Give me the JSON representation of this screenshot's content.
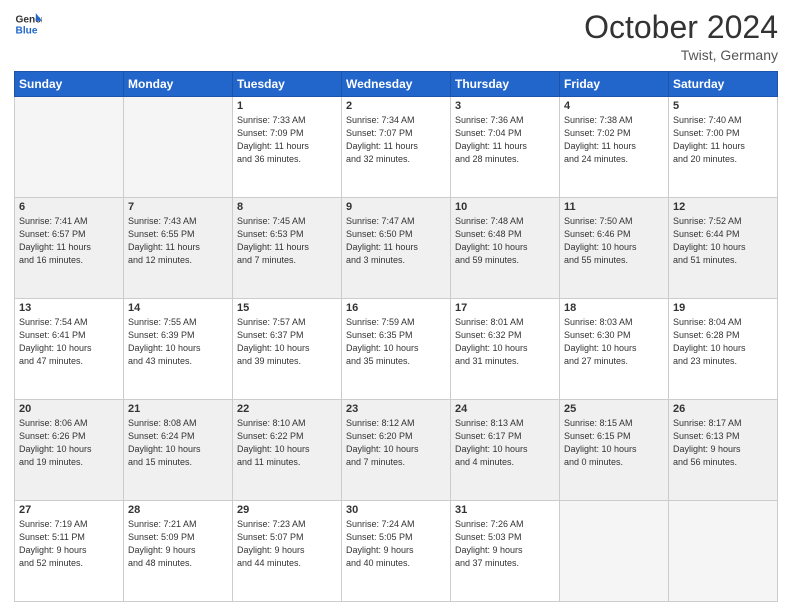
{
  "header": {
    "logo_line1": "General",
    "logo_line2": "Blue",
    "month_year": "October 2024",
    "location": "Twist, Germany"
  },
  "weekdays": [
    "Sunday",
    "Monday",
    "Tuesday",
    "Wednesday",
    "Thursday",
    "Friday",
    "Saturday"
  ],
  "weeks": [
    [
      {
        "day": "",
        "info": ""
      },
      {
        "day": "",
        "info": ""
      },
      {
        "day": "1",
        "info": "Sunrise: 7:33 AM\nSunset: 7:09 PM\nDaylight: 11 hours\nand 36 minutes."
      },
      {
        "day": "2",
        "info": "Sunrise: 7:34 AM\nSunset: 7:07 PM\nDaylight: 11 hours\nand 32 minutes."
      },
      {
        "day": "3",
        "info": "Sunrise: 7:36 AM\nSunset: 7:04 PM\nDaylight: 11 hours\nand 28 minutes."
      },
      {
        "day": "4",
        "info": "Sunrise: 7:38 AM\nSunset: 7:02 PM\nDaylight: 11 hours\nand 24 minutes."
      },
      {
        "day": "5",
        "info": "Sunrise: 7:40 AM\nSunset: 7:00 PM\nDaylight: 11 hours\nand 20 minutes."
      }
    ],
    [
      {
        "day": "6",
        "info": "Sunrise: 7:41 AM\nSunset: 6:57 PM\nDaylight: 11 hours\nand 16 minutes."
      },
      {
        "day": "7",
        "info": "Sunrise: 7:43 AM\nSunset: 6:55 PM\nDaylight: 11 hours\nand 12 minutes."
      },
      {
        "day": "8",
        "info": "Sunrise: 7:45 AM\nSunset: 6:53 PM\nDaylight: 11 hours\nand 7 minutes."
      },
      {
        "day": "9",
        "info": "Sunrise: 7:47 AM\nSunset: 6:50 PM\nDaylight: 11 hours\nand 3 minutes."
      },
      {
        "day": "10",
        "info": "Sunrise: 7:48 AM\nSunset: 6:48 PM\nDaylight: 10 hours\nand 59 minutes."
      },
      {
        "day": "11",
        "info": "Sunrise: 7:50 AM\nSunset: 6:46 PM\nDaylight: 10 hours\nand 55 minutes."
      },
      {
        "day": "12",
        "info": "Sunrise: 7:52 AM\nSunset: 6:44 PM\nDaylight: 10 hours\nand 51 minutes."
      }
    ],
    [
      {
        "day": "13",
        "info": "Sunrise: 7:54 AM\nSunset: 6:41 PM\nDaylight: 10 hours\nand 47 minutes."
      },
      {
        "day": "14",
        "info": "Sunrise: 7:55 AM\nSunset: 6:39 PM\nDaylight: 10 hours\nand 43 minutes."
      },
      {
        "day": "15",
        "info": "Sunrise: 7:57 AM\nSunset: 6:37 PM\nDaylight: 10 hours\nand 39 minutes."
      },
      {
        "day": "16",
        "info": "Sunrise: 7:59 AM\nSunset: 6:35 PM\nDaylight: 10 hours\nand 35 minutes."
      },
      {
        "day": "17",
        "info": "Sunrise: 8:01 AM\nSunset: 6:32 PM\nDaylight: 10 hours\nand 31 minutes."
      },
      {
        "day": "18",
        "info": "Sunrise: 8:03 AM\nSunset: 6:30 PM\nDaylight: 10 hours\nand 27 minutes."
      },
      {
        "day": "19",
        "info": "Sunrise: 8:04 AM\nSunset: 6:28 PM\nDaylight: 10 hours\nand 23 minutes."
      }
    ],
    [
      {
        "day": "20",
        "info": "Sunrise: 8:06 AM\nSunset: 6:26 PM\nDaylight: 10 hours\nand 19 minutes."
      },
      {
        "day": "21",
        "info": "Sunrise: 8:08 AM\nSunset: 6:24 PM\nDaylight: 10 hours\nand 15 minutes."
      },
      {
        "day": "22",
        "info": "Sunrise: 8:10 AM\nSunset: 6:22 PM\nDaylight: 10 hours\nand 11 minutes."
      },
      {
        "day": "23",
        "info": "Sunrise: 8:12 AM\nSunset: 6:20 PM\nDaylight: 10 hours\nand 7 minutes."
      },
      {
        "day": "24",
        "info": "Sunrise: 8:13 AM\nSunset: 6:17 PM\nDaylight: 10 hours\nand 4 minutes."
      },
      {
        "day": "25",
        "info": "Sunrise: 8:15 AM\nSunset: 6:15 PM\nDaylight: 10 hours\nand 0 minutes."
      },
      {
        "day": "26",
        "info": "Sunrise: 8:17 AM\nSunset: 6:13 PM\nDaylight: 9 hours\nand 56 minutes."
      }
    ],
    [
      {
        "day": "27",
        "info": "Sunrise: 7:19 AM\nSunset: 5:11 PM\nDaylight: 9 hours\nand 52 minutes."
      },
      {
        "day": "28",
        "info": "Sunrise: 7:21 AM\nSunset: 5:09 PM\nDaylight: 9 hours\nand 48 minutes."
      },
      {
        "day": "29",
        "info": "Sunrise: 7:23 AM\nSunset: 5:07 PM\nDaylight: 9 hours\nand 44 minutes."
      },
      {
        "day": "30",
        "info": "Sunrise: 7:24 AM\nSunset: 5:05 PM\nDaylight: 9 hours\nand 40 minutes."
      },
      {
        "day": "31",
        "info": "Sunrise: 7:26 AM\nSunset: 5:03 PM\nDaylight: 9 hours\nand 37 minutes."
      },
      {
        "day": "",
        "info": ""
      },
      {
        "day": "",
        "info": ""
      }
    ]
  ]
}
